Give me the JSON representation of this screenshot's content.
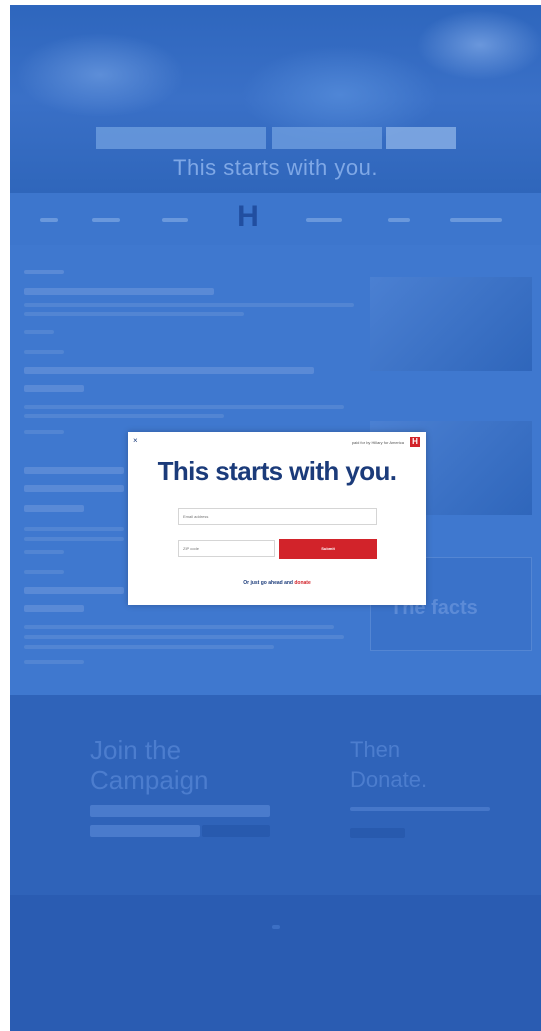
{
  "modal": {
    "paid_for": "paid for by Hillary for America",
    "logo_letter": "H",
    "close_symbol": "×",
    "title": "This starts with you.",
    "email_placeholder": "Email address",
    "zip_placeholder": "ZIP code",
    "submit_label": "Submit",
    "skip_prefix": "Or just go ahead and ",
    "skip_link": "donate"
  },
  "background_site": {
    "hero_title": "This starts with you.",
    "nav_logo": "H",
    "thumbnail_text": "The facts",
    "join_title_line1": "Join the",
    "join_title_line2": "Campaign",
    "donate_title_line1": "Then",
    "donate_title_line2": "Donate."
  },
  "colors": {
    "overlay_blue": "#3f78cf",
    "brand_navy": "#1b3b7a",
    "brand_red": "#d2232a"
  }
}
